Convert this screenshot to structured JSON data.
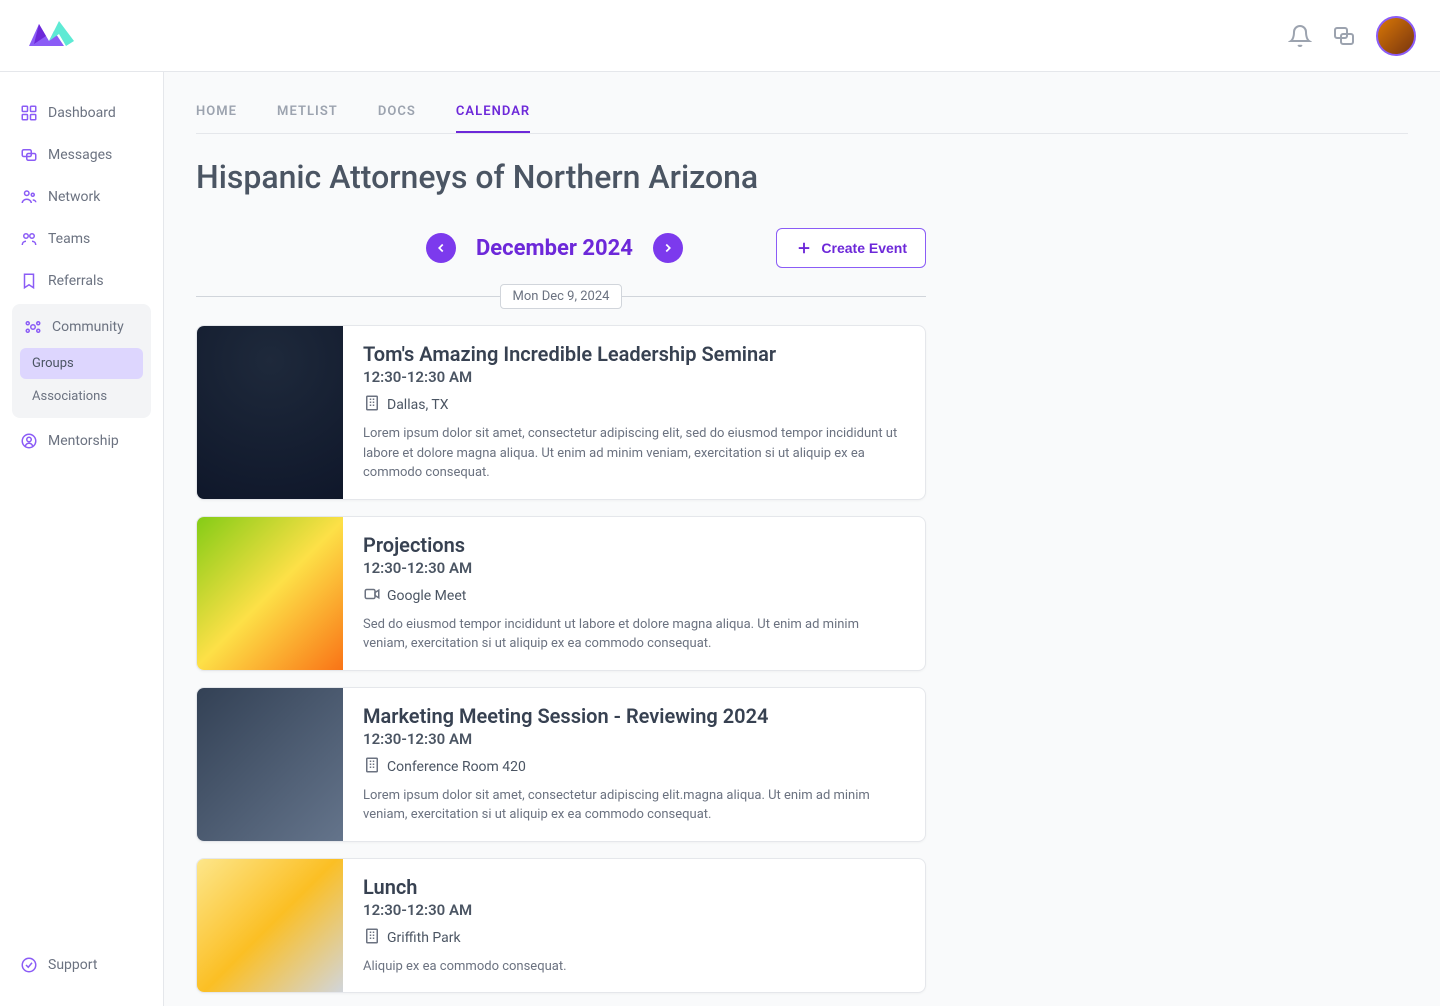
{
  "header": {
    "notifications_icon": "bell-icon",
    "messages_icon": "chat-icon"
  },
  "sidebar": {
    "items": [
      {
        "label": "Dashboard",
        "icon": "grid"
      },
      {
        "label": "Messages",
        "icon": "chat"
      },
      {
        "label": "Network",
        "icon": "people"
      },
      {
        "label": "Teams",
        "icon": "team"
      },
      {
        "label": "Referrals",
        "icon": "bookmark"
      }
    ],
    "community": {
      "label": "Community",
      "subitems": [
        {
          "label": "Groups",
          "active": true
        },
        {
          "label": "Associations",
          "active": false
        }
      ]
    },
    "mentorship_label": "Mentorship",
    "support_label": "Support"
  },
  "tabs": [
    {
      "label": "HOME",
      "active": false
    },
    {
      "label": "METLIST",
      "active": false
    },
    {
      "label": "DOCS",
      "active": false
    },
    {
      "label": "CALENDAR",
      "active": true
    }
  ],
  "page_title": "Hispanic Attorneys of Northern Arizona",
  "calendar": {
    "month_label": "December 2024",
    "create_label": "Create Event",
    "date_header": "Mon Dec 9, 2024",
    "events": [
      {
        "title": "Tom's Amazing Incredible Leadership Seminar",
        "time": "12:30-12:30 AM",
        "location_icon": "building",
        "location": "Dallas, TX",
        "description": "Lorem ipsum dolor sit amet, consectetur adipiscing elit, sed do eiusmod tempor incididunt ut labore et dolore magna aliqua. Ut enim ad minim veniam, exercitation si ut aliquip ex ea commodo consequat."
      },
      {
        "title": "Projections",
        "time": "12:30-12:30 AM",
        "location_icon": "video",
        "location": "Google Meet",
        "description": "Sed do eiusmod tempor incididunt ut labore et dolore magna aliqua. Ut enim ad minim veniam, exercitation si ut aliquip ex ea commodo consequat."
      },
      {
        "title": "Marketing Meeting Session - Reviewing 2024",
        "time": "12:30-12:30 AM",
        "location_icon": "building",
        "location": "Conference Room 420",
        "description": "Lorem ipsum dolor sit amet, consectetur adipiscing elit.magna aliqua. Ut enim ad minim veniam, exercitation si ut aliquip ex ea commodo consequat."
      },
      {
        "title": "Lunch",
        "time": "12:30-12:30 AM",
        "location_icon": "building",
        "location": "Griffith Park",
        "description": "Aliquip ex ea commodo consequat."
      }
    ]
  }
}
